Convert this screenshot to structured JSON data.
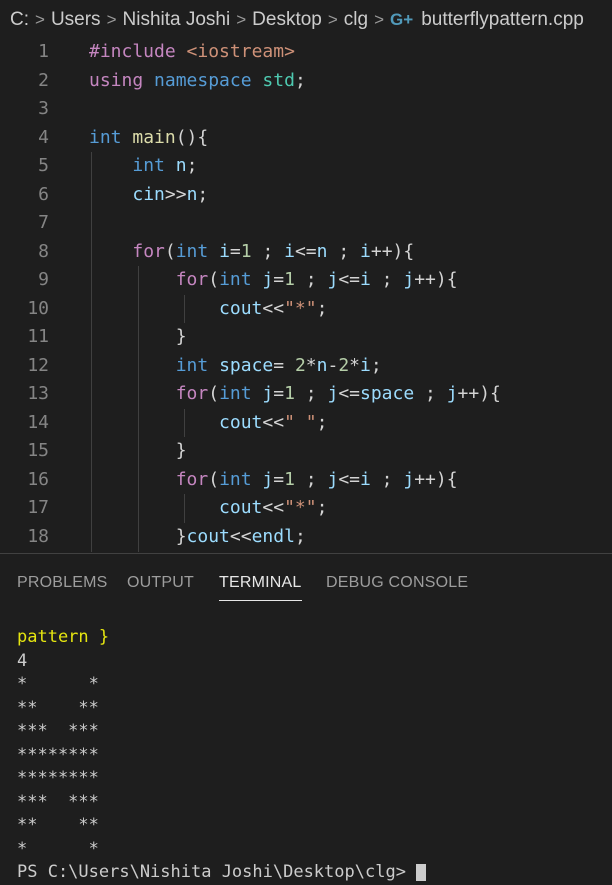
{
  "breadcrumb": {
    "items": [
      "C:",
      "Users",
      "Nishita Joshi",
      "Desktop",
      "clg"
    ],
    "file": "butterflypattern.cpp",
    "file_icon": "cpp-file-icon"
  },
  "code_lines": [
    {
      "num": "1",
      "tokens": [
        {
          "t": "#include",
          "c": "pp"
        },
        {
          "t": " ",
          "c": "o"
        },
        {
          "t": "<iostream>",
          "c": "s"
        }
      ]
    },
    {
      "num": "2",
      "tokens": [
        {
          "t": "using",
          "c": "pp"
        },
        {
          "t": " ",
          "c": "o"
        },
        {
          "t": "namespace",
          "c": "k"
        },
        {
          "t": " ",
          "c": "o"
        },
        {
          "t": "std",
          "c": "t"
        },
        {
          "t": ";",
          "c": "o"
        }
      ]
    },
    {
      "num": "3",
      "tokens": []
    },
    {
      "num": "4",
      "tokens": [
        {
          "t": "int",
          "c": "k"
        },
        {
          "t": " ",
          "c": "o"
        },
        {
          "t": "main",
          "c": "f"
        },
        {
          "t": "(){",
          "c": "o"
        }
      ]
    },
    {
      "num": "5",
      "tokens": [
        {
          "t": "    ",
          "c": "o"
        },
        {
          "t": "int",
          "c": "k"
        },
        {
          "t": " ",
          "c": "o"
        },
        {
          "t": "n",
          "c": "v"
        },
        {
          "t": ";",
          "c": "o"
        }
      ]
    },
    {
      "num": "6",
      "tokens": [
        {
          "t": "    ",
          "c": "o"
        },
        {
          "t": "cin",
          "c": "v"
        },
        {
          "t": ">>",
          "c": "o"
        },
        {
          "t": "n",
          "c": "v"
        },
        {
          "t": ";",
          "c": "o"
        }
      ]
    },
    {
      "num": "7",
      "tokens": []
    },
    {
      "num": "8",
      "tokens": [
        {
          "t": "    ",
          "c": "o"
        },
        {
          "t": "for",
          "c": "pp"
        },
        {
          "t": "(",
          "c": "o"
        },
        {
          "t": "int",
          "c": "k"
        },
        {
          "t": " ",
          "c": "o"
        },
        {
          "t": "i",
          "c": "v"
        },
        {
          "t": "=",
          "c": "o"
        },
        {
          "t": "1",
          "c": "n"
        },
        {
          "t": " ; ",
          "c": "o"
        },
        {
          "t": "i",
          "c": "v"
        },
        {
          "t": "<=",
          "c": "o"
        },
        {
          "t": "n",
          "c": "v"
        },
        {
          "t": " ; ",
          "c": "o"
        },
        {
          "t": "i",
          "c": "v"
        },
        {
          "t": "++){",
          "c": "o"
        }
      ]
    },
    {
      "num": "9",
      "tokens": [
        {
          "t": "        ",
          "c": "o"
        },
        {
          "t": "for",
          "c": "pp"
        },
        {
          "t": "(",
          "c": "o"
        },
        {
          "t": "int",
          "c": "k"
        },
        {
          "t": " ",
          "c": "o"
        },
        {
          "t": "j",
          "c": "v"
        },
        {
          "t": "=",
          "c": "o"
        },
        {
          "t": "1",
          "c": "n"
        },
        {
          "t": " ; ",
          "c": "o"
        },
        {
          "t": "j",
          "c": "v"
        },
        {
          "t": "<=",
          "c": "o"
        },
        {
          "t": "i",
          "c": "v"
        },
        {
          "t": " ; ",
          "c": "o"
        },
        {
          "t": "j",
          "c": "v"
        },
        {
          "t": "++){",
          "c": "o"
        }
      ]
    },
    {
      "num": "10",
      "tokens": [
        {
          "t": "            ",
          "c": "o"
        },
        {
          "t": "cout",
          "c": "v"
        },
        {
          "t": "<<",
          "c": "o"
        },
        {
          "t": "\"*\"",
          "c": "s"
        },
        {
          "t": ";",
          "c": "o"
        }
      ]
    },
    {
      "num": "11",
      "tokens": [
        {
          "t": "        ",
          "c": "o"
        },
        {
          "t": "}",
          "c": "o"
        }
      ]
    },
    {
      "num": "12",
      "tokens": [
        {
          "t": "        ",
          "c": "o"
        },
        {
          "t": "int",
          "c": "k"
        },
        {
          "t": " ",
          "c": "o"
        },
        {
          "t": "space",
          "c": "v"
        },
        {
          "t": "= ",
          "c": "o"
        },
        {
          "t": "2",
          "c": "n"
        },
        {
          "t": "*",
          "c": "o"
        },
        {
          "t": "n",
          "c": "v"
        },
        {
          "t": "-",
          "c": "o"
        },
        {
          "t": "2",
          "c": "n"
        },
        {
          "t": "*",
          "c": "o"
        },
        {
          "t": "i",
          "c": "v"
        },
        {
          "t": ";",
          "c": "o"
        }
      ]
    },
    {
      "num": "13",
      "tokens": [
        {
          "t": "        ",
          "c": "o"
        },
        {
          "t": "for",
          "c": "pp"
        },
        {
          "t": "(",
          "c": "o"
        },
        {
          "t": "int",
          "c": "k"
        },
        {
          "t": " ",
          "c": "o"
        },
        {
          "t": "j",
          "c": "v"
        },
        {
          "t": "=",
          "c": "o"
        },
        {
          "t": "1",
          "c": "n"
        },
        {
          "t": " ; ",
          "c": "o"
        },
        {
          "t": "j",
          "c": "v"
        },
        {
          "t": "<=",
          "c": "o"
        },
        {
          "t": "space",
          "c": "v"
        },
        {
          "t": " ; ",
          "c": "o"
        },
        {
          "t": "j",
          "c": "v"
        },
        {
          "t": "++){",
          "c": "o"
        }
      ]
    },
    {
      "num": "14",
      "tokens": [
        {
          "t": "            ",
          "c": "o"
        },
        {
          "t": "cout",
          "c": "v"
        },
        {
          "t": "<<",
          "c": "o"
        },
        {
          "t": "\" \"",
          "c": "s"
        },
        {
          "t": ";",
          "c": "o"
        }
      ]
    },
    {
      "num": "15",
      "tokens": [
        {
          "t": "        ",
          "c": "o"
        },
        {
          "t": "}",
          "c": "o"
        }
      ]
    },
    {
      "num": "16",
      "tokens": [
        {
          "t": "        ",
          "c": "o"
        },
        {
          "t": "for",
          "c": "pp"
        },
        {
          "t": "(",
          "c": "o"
        },
        {
          "t": "int",
          "c": "k"
        },
        {
          "t": " ",
          "c": "o"
        },
        {
          "t": "j",
          "c": "v"
        },
        {
          "t": "=",
          "c": "o"
        },
        {
          "t": "1",
          "c": "n"
        },
        {
          "t": " ; ",
          "c": "o"
        },
        {
          "t": "j",
          "c": "v"
        },
        {
          "t": "<=",
          "c": "o"
        },
        {
          "t": "i",
          "c": "v"
        },
        {
          "t": " ; ",
          "c": "o"
        },
        {
          "t": "j",
          "c": "v"
        },
        {
          "t": "++){",
          "c": "o"
        }
      ]
    },
    {
      "num": "17",
      "tokens": [
        {
          "t": "            ",
          "c": "o"
        },
        {
          "t": "cout",
          "c": "v"
        },
        {
          "t": "<<",
          "c": "o"
        },
        {
          "t": "\"*\"",
          "c": "s"
        },
        {
          "t": ";",
          "c": "o"
        }
      ]
    },
    {
      "num": "18",
      "tokens": [
        {
          "t": "        ",
          "c": "o"
        },
        {
          "t": "}",
          "c": "o"
        },
        {
          "t": "cout",
          "c": "v"
        },
        {
          "t": "<<",
          "c": "o"
        },
        {
          "t": "endl",
          "c": "v"
        },
        {
          "t": ";",
          "c": "o"
        }
      ]
    }
  ],
  "panel": {
    "tabs": [
      "PROBLEMS",
      "OUTPUT",
      "TERMINAL",
      "DEBUG CONSOLE"
    ],
    "active_tab": "TERMINAL"
  },
  "terminal": {
    "lines": [
      "pattern }",
      "4",
      "*      *",
      "**    **",
      "***  ***",
      "********",
      "********",
      "***  ***",
      "**    **",
      "*      *"
    ],
    "prompt": "PS C:\\Users\\Nishita Joshi\\Desktop\\clg> "
  },
  "colors": {
    "background": "#1e1e1e",
    "keyword": "#569cd6",
    "control": "#c586c0",
    "string": "#ce9178",
    "function": "#dcdcaa",
    "variable": "#9cdcfe",
    "number": "#b5cea8",
    "type": "#4ec9b0"
  }
}
